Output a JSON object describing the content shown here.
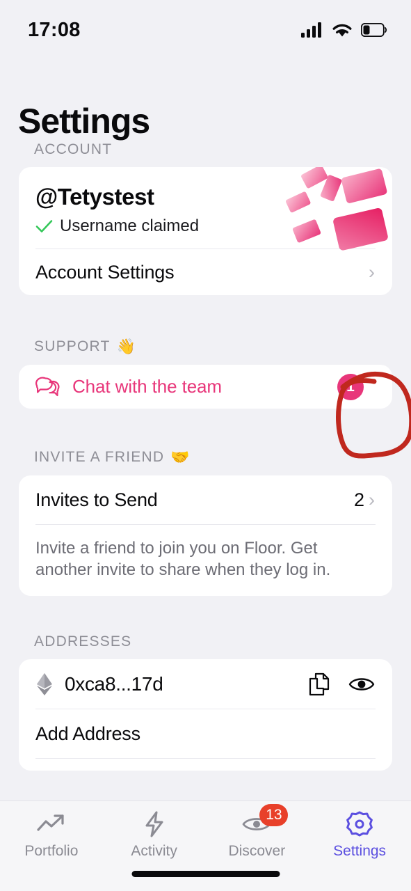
{
  "status_bar": {
    "time": "17:08",
    "cellular_icon": "cellular-signal-icon",
    "wifi_icon": "wifi-icon",
    "battery_icon": "battery-low-icon"
  },
  "header": {
    "title": "Settings"
  },
  "sections": {
    "account": {
      "label": "ACCOUNT",
      "username": "@Tetystest",
      "claimed_text": "Username claimed",
      "claimed_icon": "green-check-icon",
      "account_settings_label": "Account Settings",
      "chevron": "›",
      "art": "pink-cards-illustration"
    },
    "support": {
      "label": "SUPPORT",
      "emoji": "👋",
      "chat_label": "Chat with the team",
      "chat_icon": "chat-bubbles-icon",
      "badge_count": "1"
    },
    "invite": {
      "label": "INVITE A FRIEND",
      "emoji": "🤝",
      "row_label": "Invites to Send",
      "row_value": "2",
      "chevron": "›",
      "note": "Invite a friend to join you on Floor. Get another invite to share when they log in."
    },
    "addresses": {
      "label": "ADDRESSES",
      "wallet_icon": "ethereum-icon",
      "wallet_address": "0xca8...17d",
      "copy_icon": "copy-icon",
      "visibility_icon": "eye-icon",
      "add_address_label": "Add Address"
    }
  },
  "annotation": {
    "shape": "hand-drawn-circle",
    "color": "#c0281e",
    "target": "support-badge"
  },
  "tabbar": {
    "tabs": [
      {
        "label": "Portfolio",
        "icon": "trending-up-icon",
        "active": false,
        "badge": ""
      },
      {
        "label": "Activity",
        "icon": "lightning-bolt-icon",
        "active": false,
        "badge": ""
      },
      {
        "label": "Discover",
        "icon": "eye-icon",
        "active": false,
        "badge": "13"
      },
      {
        "label": "Settings",
        "icon": "gear-icon",
        "active": true,
        "badge": ""
      }
    ]
  },
  "colors": {
    "background": "#f1f1f5",
    "card": "#ffffff",
    "accent_pink": "#e8367a",
    "accent_purple": "#5b4fe0",
    "badge_red": "#e8402a",
    "check_green": "#34c759",
    "annotation_red": "#c0281e"
  }
}
